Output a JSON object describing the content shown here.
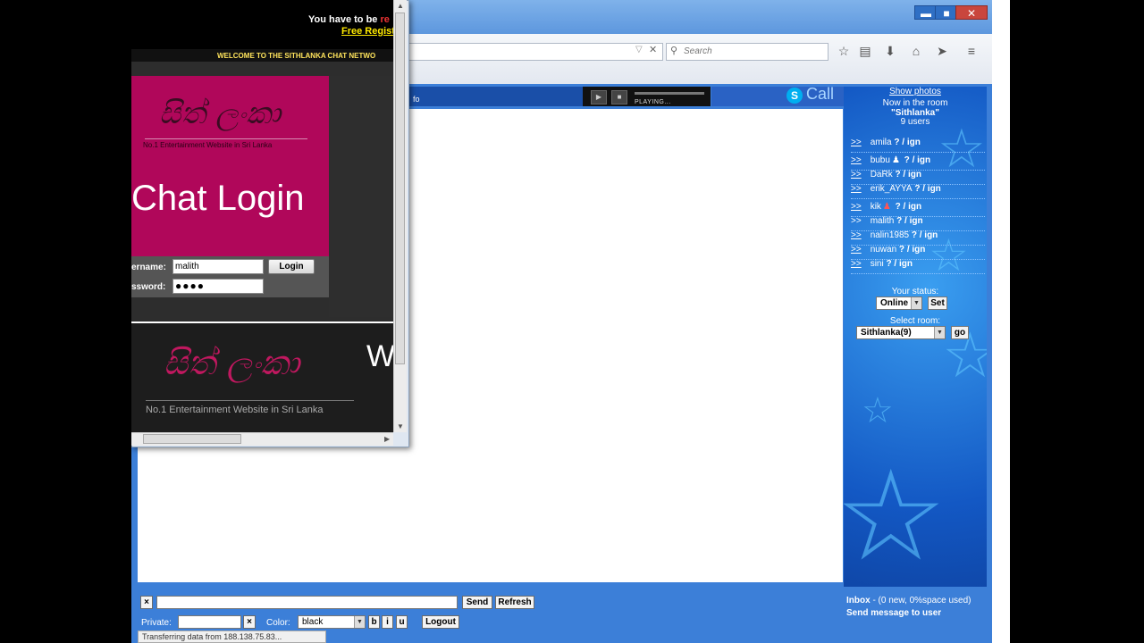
{
  "browser": {
    "window_buttons": {
      "minimize": "▬",
      "maximize": "■",
      "close": "✕"
    },
    "url_clear": "✕",
    "search_placeholder": "Search",
    "toolbar_icons": [
      "star-icon",
      "bookmarks-icon",
      "download-icon",
      "home-icon",
      "send-icon",
      "menu-icon"
    ],
    "status_bar": "Transferring data from 188.138.75.83..."
  },
  "chat": {
    "header_text": "fo",
    "player_status": "PLAYING...",
    "skype_label": "Call",
    "skype_icon": "S",
    "sidebar": {
      "show_photos": "Show photos",
      "now_in_room": "Now in the room",
      "room_name": "\"Sithlanka\"",
      "user_count": "9 users",
      "users": [
        {
          "arrow": ">>",
          "name": "amila",
          "suffix": " ? / ",
          "ign": "ign"
        },
        {
          "arrow": ">>",
          "name": "bubu",
          "suffix": " ? / ",
          "ign": "ign"
        },
        {
          "arrow": ">>",
          "name": "DaRk",
          "suffix": " ? / ",
          "ign": "ign"
        },
        {
          "arrow": ">>",
          "name": "erik_AYYA",
          "suffix": " ? / ",
          "ign": "ign"
        },
        {
          "arrow": ">>",
          "name": "kik",
          "suffix": " ? / ",
          "ign": "ign"
        },
        {
          "arrow": ">>",
          "name": "malith",
          "suffix": " ? / ",
          "ign": "ign"
        },
        {
          "arrow": ">>",
          "name": "nalin1985",
          "suffix": " ? / ",
          "ign": "ign"
        },
        {
          "arrow": ">>",
          "name": "nuwan",
          "suffix": " ? / ",
          "ign": "ign"
        },
        {
          "arrow": ">>",
          "name": "sini",
          "suffix": " ? / ",
          "ign": "ign"
        }
      ],
      "status_label": "Your status:",
      "status_value": "Online",
      "set_button": "Set",
      "room_label": "Select room:",
      "room_value": "Sithlanka(9)",
      "go_button": "go"
    },
    "bottom": {
      "clear_button": "×",
      "send_button": "Send",
      "refresh_button": "Refresh",
      "private_label": "Private:",
      "private_clear": "×",
      "color_label": "Color:",
      "color_value": "black",
      "bold_button": "b",
      "italic_button": "i",
      "underline_button": "u",
      "logout_button": "Logout",
      "inbox_label": "Inbox",
      "inbox_text": " - (0 new, 0%space used)",
      "send_to_user": "Send message to user"
    }
  },
  "popup": {
    "must_be": "You have to be ",
    "must_be_red": "re",
    "free_registration": "Free Regist",
    "welcome": "WELCOME TO THE SITHLANKA CHAT NETWO",
    "logo_script": "සිත් ලංකා",
    "tagline": "No.1 Entertainment Website in Sri Lanka",
    "title": "Chat Login",
    "username_label": "ername:",
    "username_value": "malith",
    "login_button": "Login",
    "password_label": "ssword:",
    "password_value": "●●●●",
    "banner_script": "සිත් ලංකා",
    "banner_tagline": "No.1 Entertainment Website in Sri Lanka",
    "banner_w": "W"
  }
}
